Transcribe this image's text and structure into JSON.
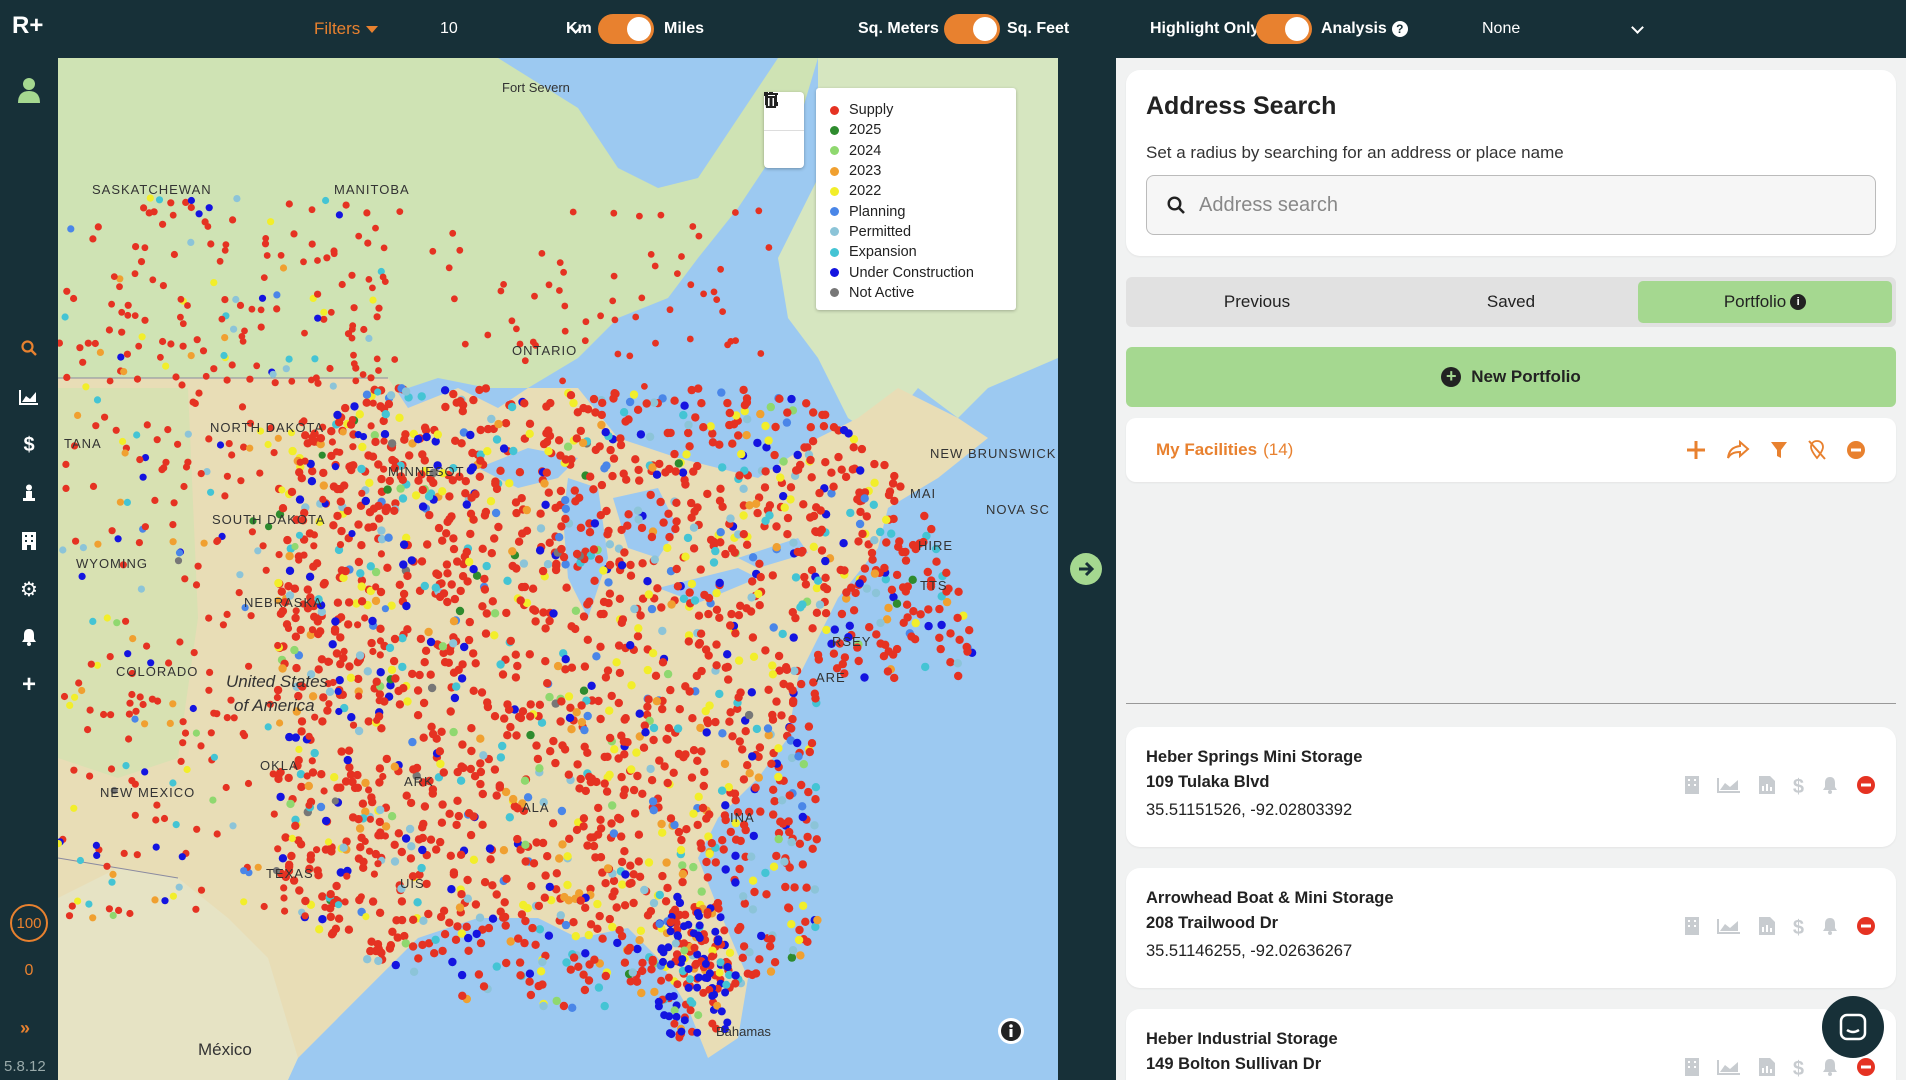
{
  "app": {
    "logo": "R+",
    "version": "5.8.12"
  },
  "topbar": {
    "filters_label": "Filters",
    "radius_value": "10",
    "km_label": "Km",
    "miles_label": "Miles",
    "sqm_label": "Sq. Meters",
    "sqft_label": "Sq. Feet",
    "highlight_label": "Highlight Only",
    "analysis_label": "Analysis",
    "dropdown_value": "None",
    "accent_color": "#e8812f"
  },
  "rail": {
    "items": [
      "user-icon",
      "search-icon",
      "chart-icon",
      "dollar-icon",
      "person-icon",
      "building-icon",
      "gear-icon",
      "bell-icon",
      "plus-icon"
    ],
    "badge_value": "100",
    "badge_sub": "0"
  },
  "map": {
    "labels": {
      "fort_severn": "Fort Severn",
      "saskatchewan": "SASKATCHEWAN",
      "manitoba": "MANITOBA",
      "ontario": "ONTARIO",
      "north_dakota": "NORTH DAKOTA",
      "south_dakota": "SOUTH DAKOTA",
      "wyoming": "WYOMING",
      "nebraska": "NEBRASKA",
      "colorado": "COLORADO",
      "new_mexico": "NEW MEXICO",
      "texas": "TEXAS",
      "oklahoma": "OKLA",
      "united_states": "United States",
      "of_america": "of America",
      "mexico": "México",
      "bahamas": "Bahamas",
      "new_brunswick": "NEW BRUNSWICK",
      "nova_scotia": "NOVA SC",
      "minnesota": "MINNESOT",
      "montana": "TANA",
      "maine": "MAI",
      "hampshire": "HIRE",
      "massachusetts": "TTS",
      "jersey": "RSEY",
      "delaware": "ARE",
      "arkansas": "ARK",
      "louisiana": "UIS",
      "alabama": "ALA",
      "carolina": "INA"
    },
    "legend": [
      {
        "label": "Supply",
        "color": "#e53222"
      },
      {
        "label": "2025",
        "color": "#2e8b2e"
      },
      {
        "label": "2024",
        "color": "#8fd86f"
      },
      {
        "label": "2023",
        "color": "#f0a030"
      },
      {
        "label": "2022",
        "color": "#f2ee2a"
      },
      {
        "label": "Planning",
        "color": "#4a86e8"
      },
      {
        "label": "Permitted",
        "color": "#8cc4d8"
      },
      {
        "label": "Expansion",
        "color": "#44c4d4"
      },
      {
        "label": "Under Construction",
        "color": "#1414e0"
      },
      {
        "label": "Not Active",
        "color": "#777777"
      }
    ]
  },
  "panel": {
    "search": {
      "title": "Address Search",
      "subtitle": "Set a radius by searching for an address or place name",
      "placeholder": "Address search"
    },
    "tabs": [
      "Previous",
      "Saved",
      "Portfolio"
    ],
    "active_tab": "Portfolio",
    "new_portfolio_label": "New Portfolio",
    "my_facilities": {
      "title": "My Facilities",
      "count": "(14)"
    },
    "facilities": [
      {
        "name": "Heber Springs Mini Storage",
        "address": "109 Tulaka Blvd",
        "coords": "35.51151526, -92.02803392"
      },
      {
        "name": "Arrowhead Boat & Mini Storage",
        "address": "208 Trailwood Dr",
        "coords": "35.51146255, -92.02636267"
      },
      {
        "name": "Heber Industrial Storage",
        "address": "149 Bolton Sullivan Dr",
        "coords": ""
      }
    ]
  }
}
